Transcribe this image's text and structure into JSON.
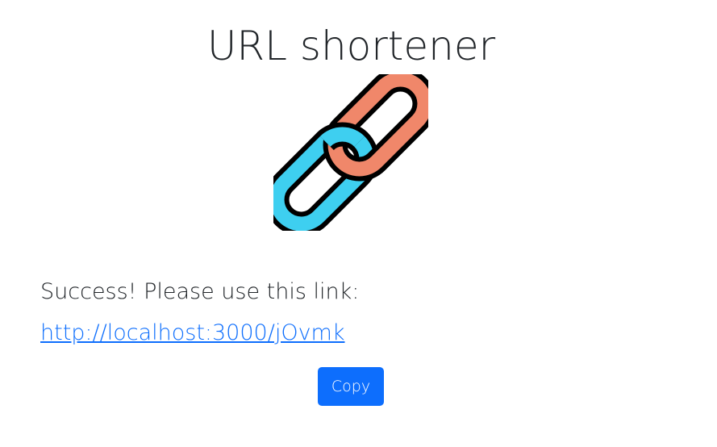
{
  "page": {
    "title": "URL shortener"
  },
  "logo": {
    "icon": "chain-link-icon",
    "colors": {
      "front_link": "#f0876a",
      "back_link": "#3ecff0",
      "outline": "#000000"
    }
  },
  "result": {
    "message": "Success! Please use this link:",
    "short_url": "http://localhost:3000/jOvmk"
  },
  "actions": {
    "copy_label": "Copy"
  },
  "theme": {
    "accent": "#0d6efd",
    "text": "#212529",
    "background": "#ffffff"
  }
}
